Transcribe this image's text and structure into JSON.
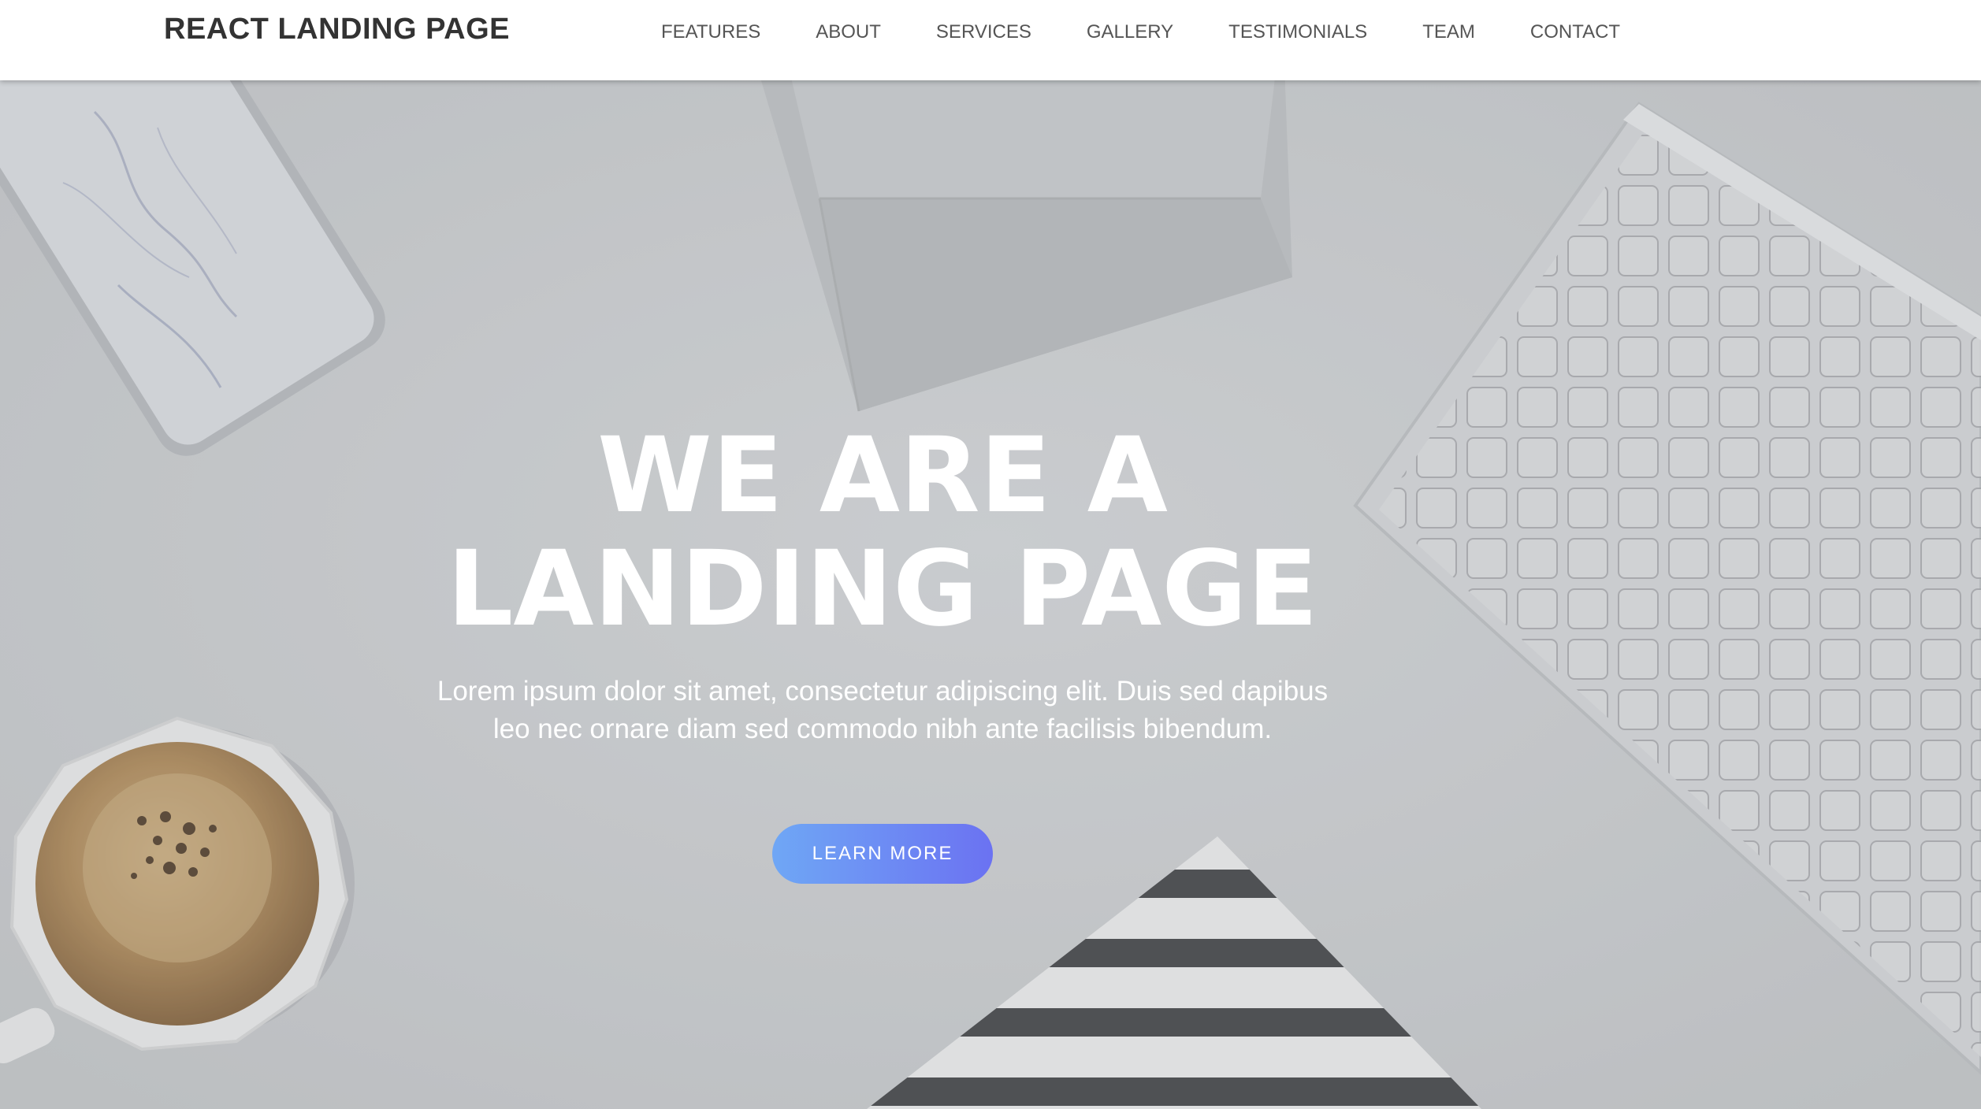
{
  "navbar": {
    "brand": "REACT LANDING PAGE",
    "items": [
      {
        "label": "FEATURES"
      },
      {
        "label": "ABOUT"
      },
      {
        "label": "SERVICES"
      },
      {
        "label": "GALLERY"
      },
      {
        "label": "TESTIMONIALS"
      },
      {
        "label": "TEAM"
      },
      {
        "label": "CONTACT"
      }
    ]
  },
  "hero": {
    "title_line1": "WE ARE A",
    "title_line2": "LANDING PAGE",
    "paragraph": "Lorem ipsum dolor sit amet, consectetur adipiscing elit. Duis sed dapibus leo nec ornare diam sed commodo nibh ante facilisis bibendum.",
    "button_label": "LEARN MORE"
  },
  "colors": {
    "nav_background": "#ffffff",
    "brand_text": "#333333",
    "nav_text": "#555555",
    "hero_text": "#ffffff",
    "button_gradient_start": "#6fa7f5",
    "button_gradient_end": "#6b72f2"
  },
  "icons": {
    "background_objects": [
      "phone-image",
      "envelope-image",
      "keyboard-image",
      "coffee-cup-image",
      "striped-paper-image"
    ]
  }
}
